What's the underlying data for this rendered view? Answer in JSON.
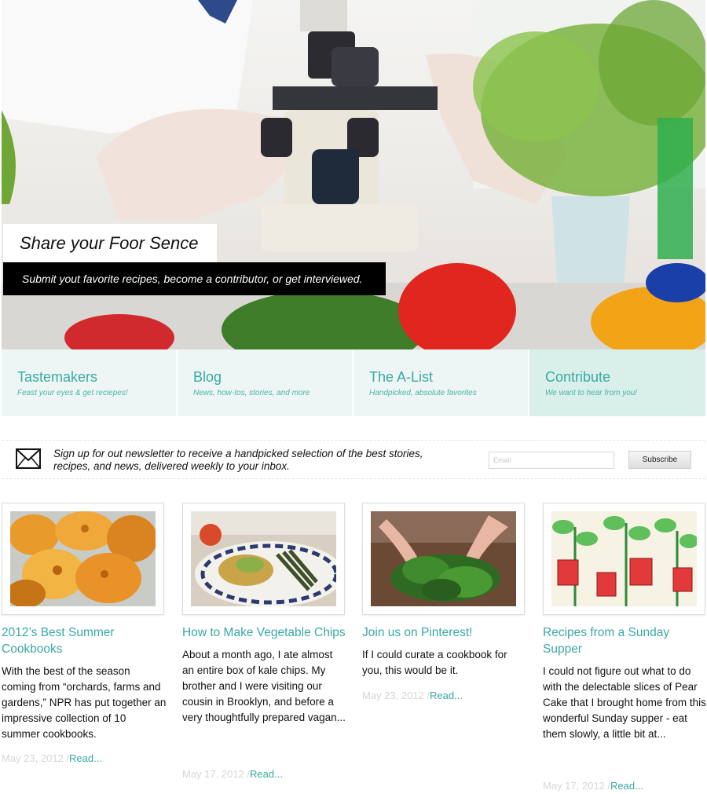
{
  "hero": {
    "title": "Share your Foor Sence",
    "subtitle": "Submit yout favorite recipes, become a contributor, or get interviewed.",
    "image_icon": "lab-microscope-vegetables-photo"
  },
  "nav": [
    {
      "title": "Tastemakers",
      "desc": "Feast your eyes & get reciepes!"
    },
    {
      "title": "Blog",
      "desc": "News, how-tos, stories, and more"
    },
    {
      "title": "The A-List",
      "desc": "Handpicked, absolute favorites"
    },
    {
      "title": "Contribute",
      "desc": "We want to hear from you!"
    }
  ],
  "newsletter": {
    "icon": "envelope-icon",
    "text": "Sign up for out newsletter to receive a handpicked selection of the best stories, recipes, and news, delivered weekly to your inbox.",
    "email_placeholder": "Email",
    "button_label": "Subscribe"
  },
  "posts": [
    {
      "title": "2012’s Best Summer Cookbooks",
      "excerpt": "With the best of the season coming from “orchards, farms and gardens,” NPR has put together an impressive collection of 10 summer cookbooks.",
      "date": "May 23, 2012",
      "sep": " /",
      "read": "Read..."
    },
    {
      "title": "How to Make Vegetable Chips",
      "excerpt": "About a month ago, I ate almost an entire box of kale chips. My brother and I were visiting our cousin in Brooklyn, and before a very thoughtfully prepared vagan...",
      "date": "May 17, 2012",
      "sep": " /",
      "read": "Read..."
    },
    {
      "title": "Join us on Pinterest!",
      "excerpt": "If I could curate a cookbook for you, this would be it.",
      "date": "May 23, 2012",
      "sep": " /",
      "read": "Read..."
    },
    {
      "title": "Recipes from a Sunday Supper",
      "excerpt": "I could not figure out what to do with the delectable slices of Pear Cake that I brought home from this wonderful Sunday supper - eat them slowly, a little bit at...",
      "date": "May 17, 2012",
      "sep": " /",
      "read": "Read..."
    }
  ]
}
